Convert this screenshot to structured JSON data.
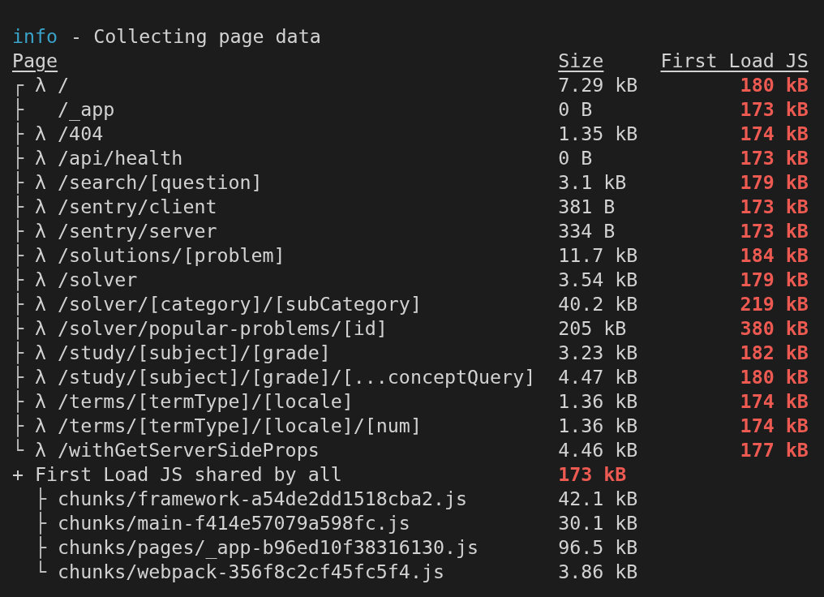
{
  "log": {
    "level": "info",
    "message": "- Collecting page data"
  },
  "columns": [
    "Page",
    "Size",
    "First Load JS"
  ],
  "pages": [
    {
      "tree": "┌",
      "symbol": "λ",
      "path": "/",
      "size": "7.29 kB",
      "first_load": "180 kB"
    },
    {
      "tree": "├",
      "path": "/_app",
      "size": "0 B",
      "first_load": "173 kB"
    },
    {
      "tree": "├",
      "symbol": "λ",
      "path": "/404",
      "size": "1.35 kB",
      "first_load": "174 kB"
    },
    {
      "tree": "├",
      "symbol": "λ",
      "path": "/api/health",
      "size": "0 B",
      "first_load": "173 kB"
    },
    {
      "tree": "├",
      "symbol": "λ",
      "path": "/search/[question]",
      "size": "3.1 kB",
      "first_load": "179 kB"
    },
    {
      "tree": "├",
      "symbol": "λ",
      "path": "/sentry/client",
      "size": "381 B",
      "first_load": "173 kB"
    },
    {
      "tree": "├",
      "symbol": "λ",
      "path": "/sentry/server",
      "size": "334 B",
      "first_load": "173 kB"
    },
    {
      "tree": "├",
      "symbol": "λ",
      "path": "/solutions/[problem]",
      "size": "11.7 kB",
      "first_load": "184 kB"
    },
    {
      "tree": "├",
      "symbol": "λ",
      "path": "/solver",
      "size": "3.54 kB",
      "first_load": "179 kB"
    },
    {
      "tree": "├",
      "symbol": "λ",
      "path": "/solver/[category]/[subCategory]",
      "size": "40.2 kB",
      "first_load": "219 kB"
    },
    {
      "tree": "├",
      "symbol": "λ",
      "path": "/solver/popular-problems/[id]",
      "size": "205 kB",
      "first_load": "380 kB"
    },
    {
      "tree": "├",
      "symbol": "λ",
      "path": "/study/[subject]/[grade]",
      "size": "3.23 kB",
      "first_load": "182 kB"
    },
    {
      "tree": "├",
      "symbol": "λ",
      "path": "/study/[subject]/[grade]/[...conceptQuery]",
      "size": "4.47 kB",
      "first_load": "180 kB"
    },
    {
      "tree": "├",
      "symbol": "λ",
      "path": "/terms/[termType]/[locale]",
      "size": "1.36 kB",
      "first_load": "174 kB"
    },
    {
      "tree": "├",
      "symbol": "λ",
      "path": "/terms/[termType]/[locale]/[num]",
      "size": "1.36 kB",
      "first_load": "174 kB"
    },
    {
      "tree": "└",
      "symbol": "λ",
      "path": "/withGetServerSideProps",
      "size": "4.46 kB",
      "first_load": "177 kB"
    }
  ],
  "shared": {
    "marker": "+",
    "label": "First Load JS shared by all",
    "size": "173 kB",
    "chunks": [
      {
        "tree": "├",
        "file": "chunks/framework-a54de2dd1518cba2.js",
        "size": "42.1 kB"
      },
      {
        "tree": "├",
        "file": "chunks/main-f414e57079a598fc.js",
        "size": "30.1 kB"
      },
      {
        "tree": "├",
        "file": "chunks/pages/_app-b96ed10f38316130.js",
        "size": "96.5 kB"
      },
      {
        "tree": "└",
        "file": "chunks/webpack-356f8c2cf45fc5f4.js",
        "size": "3.86 kB"
      }
    ]
  }
}
